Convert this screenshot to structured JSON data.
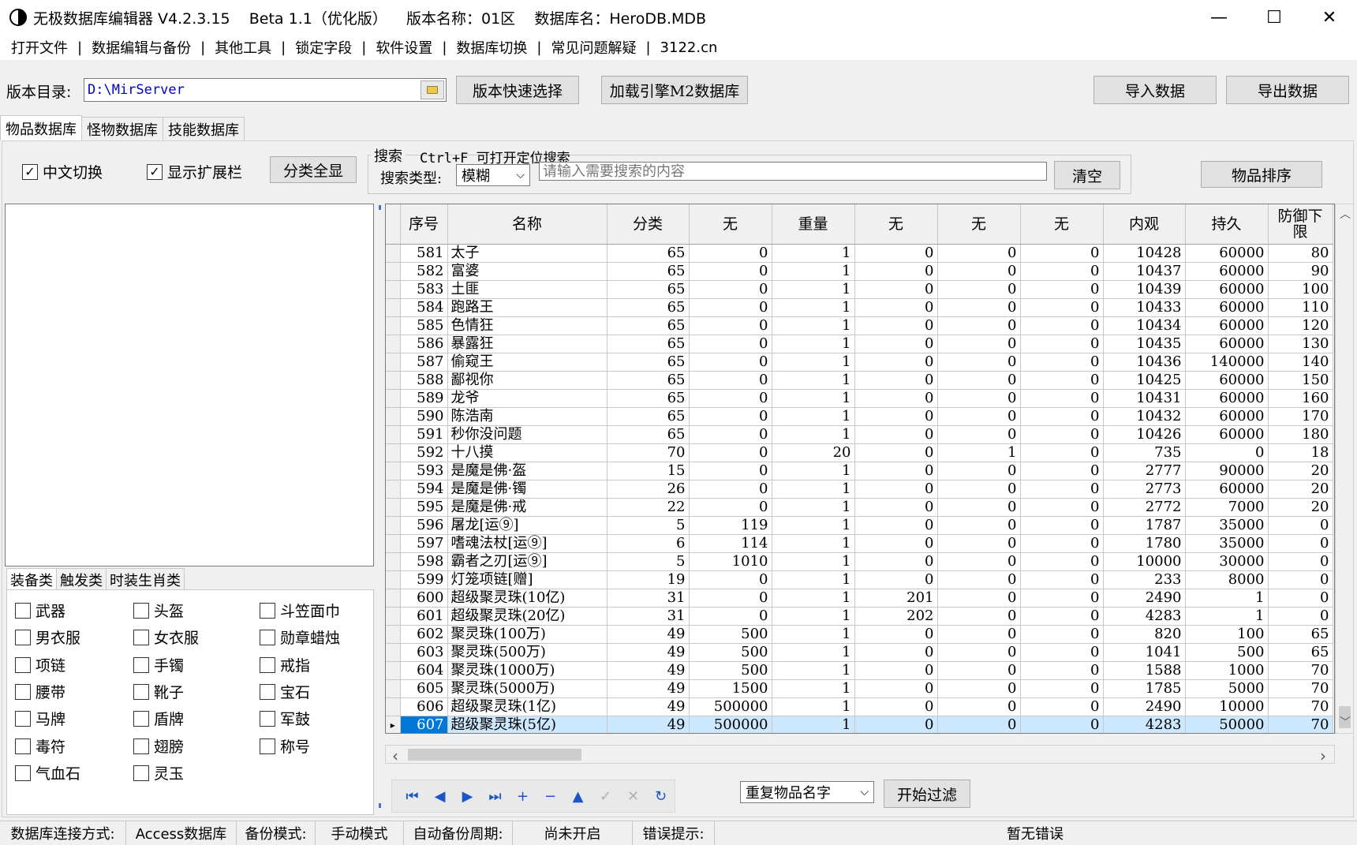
{
  "title": "无极数据库编辑器 V4.2.3.15    Beta 1.1（优化版）    版本名称：01区    数据库名：HeroDB.MDB",
  "window": {
    "minimize": "—",
    "maximize": "☐",
    "close": "✕"
  },
  "menu": [
    "打开文件",
    "数据编辑与备份",
    "其他工具",
    "锁定字段",
    "软件设置",
    "数据库切换",
    "常见问题解疑",
    "3122.cn"
  ],
  "menu_sep": "|",
  "toolbar": {
    "dir_label": "版本目录:",
    "dir_value": "D:\\MirServer",
    "quick_select": "版本快速选择",
    "load_m2": "加载引擎M2数据库",
    "import": "导入数据",
    "export": "导出数据"
  },
  "tabs": [
    "物品数据库",
    "怪物数据库",
    "技能数据库"
  ],
  "options": {
    "chinese_switch": "中文切换",
    "show_ext": "显示扩展栏",
    "show_all": "分类全显",
    "check_mark": "✓"
  },
  "search": {
    "group_title": "搜索",
    "hint": "Ctrl+F 可打开定位搜索",
    "type_label": "搜索类型:",
    "type_value": "模糊",
    "placeholder": "请输入需要搜索的内容",
    "clear": "清空",
    "sort": "物品排序"
  },
  "subtabs": [
    "装备类",
    "触发类",
    "时装生肖类"
  ],
  "categories": [
    "武器",
    "头盔",
    "斗笠面巾",
    "男衣服",
    "女衣服",
    "勋章蜡烛",
    "项链",
    "手镯",
    "戒指",
    "腰带",
    "靴子",
    "宝石",
    "马牌",
    "盾牌",
    "军鼓",
    "毒符",
    "翅膀",
    "称号",
    "气血石",
    "灵玉"
  ],
  "grid": {
    "columns": [
      "序号",
      "名称",
      "分类",
      "无",
      "重量",
      "无",
      "无",
      "无",
      "内观",
      "持久",
      "防御下限"
    ],
    "rows": [
      [
        "581",
        "太子",
        "65",
        "0",
        "1",
        "0",
        "0",
        "0",
        "10428",
        "60000",
        "80"
      ],
      [
        "582",
        "富婆",
        "65",
        "0",
        "1",
        "0",
        "0",
        "0",
        "10437",
        "60000",
        "90"
      ],
      [
        "583",
        "土匪",
        "65",
        "0",
        "1",
        "0",
        "0",
        "0",
        "10439",
        "60000",
        "100"
      ],
      [
        "584",
        "跑路王",
        "65",
        "0",
        "1",
        "0",
        "0",
        "0",
        "10433",
        "60000",
        "110"
      ],
      [
        "585",
        "色情狂",
        "65",
        "0",
        "1",
        "0",
        "0",
        "0",
        "10434",
        "60000",
        "120"
      ],
      [
        "586",
        "暴露狂",
        "65",
        "0",
        "1",
        "0",
        "0",
        "0",
        "10435",
        "60000",
        "130"
      ],
      [
        "587",
        "偷窥王",
        "65",
        "0",
        "1",
        "0",
        "0",
        "0",
        "10436",
        "140000",
        "140"
      ],
      [
        "588",
        "鄙视你",
        "65",
        "0",
        "1",
        "0",
        "0",
        "0",
        "10425",
        "60000",
        "150"
      ],
      [
        "589",
        "龙爷",
        "65",
        "0",
        "1",
        "0",
        "0",
        "0",
        "10431",
        "60000",
        "160"
      ],
      [
        "590",
        "陈浩南",
        "65",
        "0",
        "1",
        "0",
        "0",
        "0",
        "10432",
        "60000",
        "170"
      ],
      [
        "591",
        "秒你没问题",
        "65",
        "0",
        "1",
        "0",
        "0",
        "0",
        "10426",
        "60000",
        "180"
      ],
      [
        "592",
        "十八摸",
        "70",
        "0",
        "20",
        "0",
        "1",
        "0",
        "735",
        "0",
        "18"
      ],
      [
        "593",
        "是魔是佛·盔",
        "15",
        "0",
        "1",
        "0",
        "0",
        "0",
        "2777",
        "90000",
        "20"
      ],
      [
        "594",
        "是魔是佛·镯",
        "26",
        "0",
        "1",
        "0",
        "0",
        "0",
        "2773",
        "60000",
        "20"
      ],
      [
        "595",
        "是魔是佛·戒",
        "22",
        "0",
        "1",
        "0",
        "0",
        "0",
        "2772",
        "7000",
        "20"
      ],
      [
        "596",
        "屠龙[运⑨]",
        "5",
        "119",
        "1",
        "0",
        "0",
        "0",
        "1787",
        "35000",
        "0"
      ],
      [
        "597",
        "嗜魂法杖[运⑨]",
        "6",
        "114",
        "1",
        "0",
        "0",
        "0",
        "1780",
        "35000",
        "0"
      ],
      [
        "598",
        "霸者之刃[运⑨]",
        "5",
        "1010",
        "1",
        "0",
        "0",
        "0",
        "10000",
        "30000",
        "0"
      ],
      [
        "599",
        "灯笼项链[赠]",
        "19",
        "0",
        "1",
        "0",
        "0",
        "0",
        "233",
        "8000",
        "0"
      ],
      [
        "600",
        "超级聚灵珠(10亿)",
        "31",
        "0",
        "1",
        "201",
        "0",
        "0",
        "2490",
        "1",
        "0"
      ],
      [
        "601",
        "超级聚灵珠(20亿)",
        "31",
        "0",
        "1",
        "202",
        "0",
        "0",
        "4283",
        "1",
        "0"
      ],
      [
        "602",
        "聚灵珠(100万)",
        "49",
        "500",
        "1",
        "0",
        "0",
        "0",
        "820",
        "100",
        "65"
      ],
      [
        "603",
        "聚灵珠(500万)",
        "49",
        "500",
        "1",
        "0",
        "0",
        "0",
        "1041",
        "500",
        "65"
      ],
      [
        "604",
        "聚灵珠(1000万)",
        "49",
        "500",
        "1",
        "0",
        "0",
        "0",
        "1588",
        "1000",
        "70"
      ],
      [
        "605",
        "聚灵珠(5000万)",
        "49",
        "1500",
        "1",
        "0",
        "0",
        "0",
        "1785",
        "5000",
        "70"
      ],
      [
        "606",
        "超级聚灵珠(1亿)",
        "49",
        "500000",
        "1",
        "0",
        "0",
        "0",
        "2490",
        "10000",
        "70"
      ],
      [
        "607",
        "超级聚灵珠(5亿)",
        "49",
        "500000",
        "1",
        "0",
        "0",
        "0",
        "4283",
        "50000",
        "70"
      ]
    ],
    "selected_row": "607",
    "row_indicator": "▸"
  },
  "scroll": {
    "up": "︿",
    "down": "﹀",
    "left": "‹",
    "right": "›"
  },
  "navigator": {
    "first": "⏮",
    "prior": "◀",
    "next": "▶",
    "last": "⏭",
    "insert": "+",
    "delete": "−",
    "edit": "▲",
    "post": "✓",
    "cancel": "✕",
    "refresh": "↻"
  },
  "filter": {
    "type_value": "重复物品名字",
    "start": "开始过滤"
  },
  "statusbar": [
    "数据库连接方式:",
    "Access数据库",
    "备份模式:",
    "手动模式",
    "自动备份周期:",
    "尚未开启",
    "错误提示:",
    "暂无错误"
  ]
}
